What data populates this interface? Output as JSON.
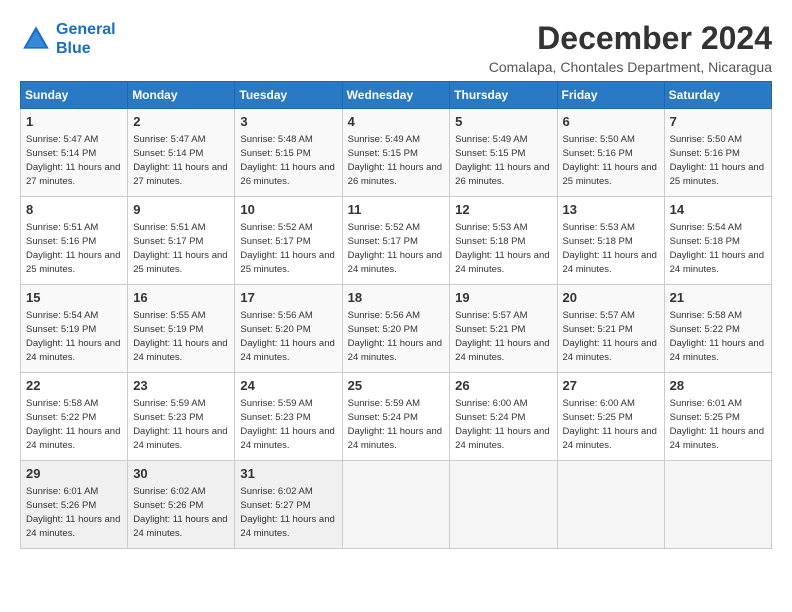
{
  "header": {
    "logo_line1": "General",
    "logo_line2": "Blue",
    "month_title": "December 2024",
    "location": "Comalapa, Chontales Department, Nicaragua"
  },
  "days_of_week": [
    "Sunday",
    "Monday",
    "Tuesday",
    "Wednesday",
    "Thursday",
    "Friday",
    "Saturday"
  ],
  "weeks": [
    [
      {
        "day": "1",
        "sunrise": "5:47 AM",
        "sunset": "5:14 PM",
        "daylight": "11 hours and 27 minutes."
      },
      {
        "day": "2",
        "sunrise": "5:47 AM",
        "sunset": "5:14 PM",
        "daylight": "11 hours and 27 minutes."
      },
      {
        "day": "3",
        "sunrise": "5:48 AM",
        "sunset": "5:15 PM",
        "daylight": "11 hours and 26 minutes."
      },
      {
        "day": "4",
        "sunrise": "5:49 AM",
        "sunset": "5:15 PM",
        "daylight": "11 hours and 26 minutes."
      },
      {
        "day": "5",
        "sunrise": "5:49 AM",
        "sunset": "5:15 PM",
        "daylight": "11 hours and 26 minutes."
      },
      {
        "day": "6",
        "sunrise": "5:50 AM",
        "sunset": "5:16 PM",
        "daylight": "11 hours and 25 minutes."
      },
      {
        "day": "7",
        "sunrise": "5:50 AM",
        "sunset": "5:16 PM",
        "daylight": "11 hours and 25 minutes."
      }
    ],
    [
      {
        "day": "8",
        "sunrise": "5:51 AM",
        "sunset": "5:16 PM",
        "daylight": "11 hours and 25 minutes."
      },
      {
        "day": "9",
        "sunrise": "5:51 AM",
        "sunset": "5:17 PM",
        "daylight": "11 hours and 25 minutes."
      },
      {
        "day": "10",
        "sunrise": "5:52 AM",
        "sunset": "5:17 PM",
        "daylight": "11 hours and 25 minutes."
      },
      {
        "day": "11",
        "sunrise": "5:52 AM",
        "sunset": "5:17 PM",
        "daylight": "11 hours and 24 minutes."
      },
      {
        "day": "12",
        "sunrise": "5:53 AM",
        "sunset": "5:18 PM",
        "daylight": "11 hours and 24 minutes."
      },
      {
        "day": "13",
        "sunrise": "5:53 AM",
        "sunset": "5:18 PM",
        "daylight": "11 hours and 24 minutes."
      },
      {
        "day": "14",
        "sunrise": "5:54 AM",
        "sunset": "5:18 PM",
        "daylight": "11 hours and 24 minutes."
      }
    ],
    [
      {
        "day": "15",
        "sunrise": "5:54 AM",
        "sunset": "5:19 PM",
        "daylight": "11 hours and 24 minutes."
      },
      {
        "day": "16",
        "sunrise": "5:55 AM",
        "sunset": "5:19 PM",
        "daylight": "11 hours and 24 minutes."
      },
      {
        "day": "17",
        "sunrise": "5:56 AM",
        "sunset": "5:20 PM",
        "daylight": "11 hours and 24 minutes."
      },
      {
        "day": "18",
        "sunrise": "5:56 AM",
        "sunset": "5:20 PM",
        "daylight": "11 hours and 24 minutes."
      },
      {
        "day": "19",
        "sunrise": "5:57 AM",
        "sunset": "5:21 PM",
        "daylight": "11 hours and 24 minutes."
      },
      {
        "day": "20",
        "sunrise": "5:57 AM",
        "sunset": "5:21 PM",
        "daylight": "11 hours and 24 minutes."
      },
      {
        "day": "21",
        "sunrise": "5:58 AM",
        "sunset": "5:22 PM",
        "daylight": "11 hours and 24 minutes."
      }
    ],
    [
      {
        "day": "22",
        "sunrise": "5:58 AM",
        "sunset": "5:22 PM",
        "daylight": "11 hours and 24 minutes."
      },
      {
        "day": "23",
        "sunrise": "5:59 AM",
        "sunset": "5:23 PM",
        "daylight": "11 hours and 24 minutes."
      },
      {
        "day": "24",
        "sunrise": "5:59 AM",
        "sunset": "5:23 PM",
        "daylight": "11 hours and 24 minutes."
      },
      {
        "day": "25",
        "sunrise": "5:59 AM",
        "sunset": "5:24 PM",
        "daylight": "11 hours and 24 minutes."
      },
      {
        "day": "26",
        "sunrise": "6:00 AM",
        "sunset": "5:24 PM",
        "daylight": "11 hours and 24 minutes."
      },
      {
        "day": "27",
        "sunrise": "6:00 AM",
        "sunset": "5:25 PM",
        "daylight": "11 hours and 24 minutes."
      },
      {
        "day": "28",
        "sunrise": "6:01 AM",
        "sunset": "5:25 PM",
        "daylight": "11 hours and 24 minutes."
      }
    ],
    [
      {
        "day": "29",
        "sunrise": "6:01 AM",
        "sunset": "5:26 PM",
        "daylight": "11 hours and 24 minutes."
      },
      {
        "day": "30",
        "sunrise": "6:02 AM",
        "sunset": "5:26 PM",
        "daylight": "11 hours and 24 minutes."
      },
      {
        "day": "31",
        "sunrise": "6:02 AM",
        "sunset": "5:27 PM",
        "daylight": "11 hours and 24 minutes."
      },
      {
        "day": "",
        "sunrise": "",
        "sunset": "",
        "daylight": ""
      },
      {
        "day": "",
        "sunrise": "",
        "sunset": "",
        "daylight": ""
      },
      {
        "day": "",
        "sunrise": "",
        "sunset": "",
        "daylight": ""
      },
      {
        "day": "",
        "sunrise": "",
        "sunset": "",
        "daylight": ""
      }
    ]
  ],
  "labels": {
    "sunrise": "Sunrise: ",
    "sunset": "Sunset: ",
    "daylight": "Daylight: "
  }
}
